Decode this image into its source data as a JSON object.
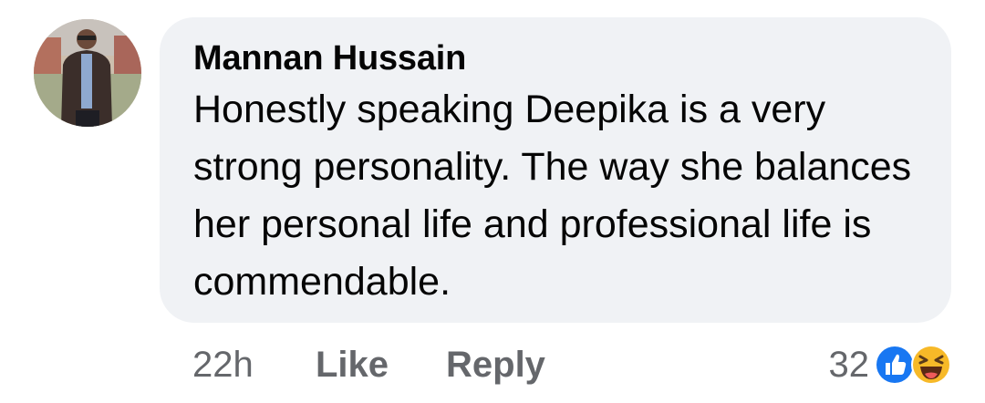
{
  "comment": {
    "author": "Mannan Hussain",
    "text": "Honestly speaking Deepika is a very strong personality. The way she balances her personal life and professional life is commendable.",
    "time": "22h",
    "like_label": "Like",
    "reply_label": "Reply",
    "reaction_count": "32",
    "reactions": [
      "like-reaction-icon",
      "haha-reaction-icon"
    ]
  },
  "colors": {
    "bubble": "#f0f2f5",
    "text": "#050505",
    "secondary": "#65676b",
    "like_blue": "#1877f2",
    "haha_yellow": "#f7b928"
  }
}
